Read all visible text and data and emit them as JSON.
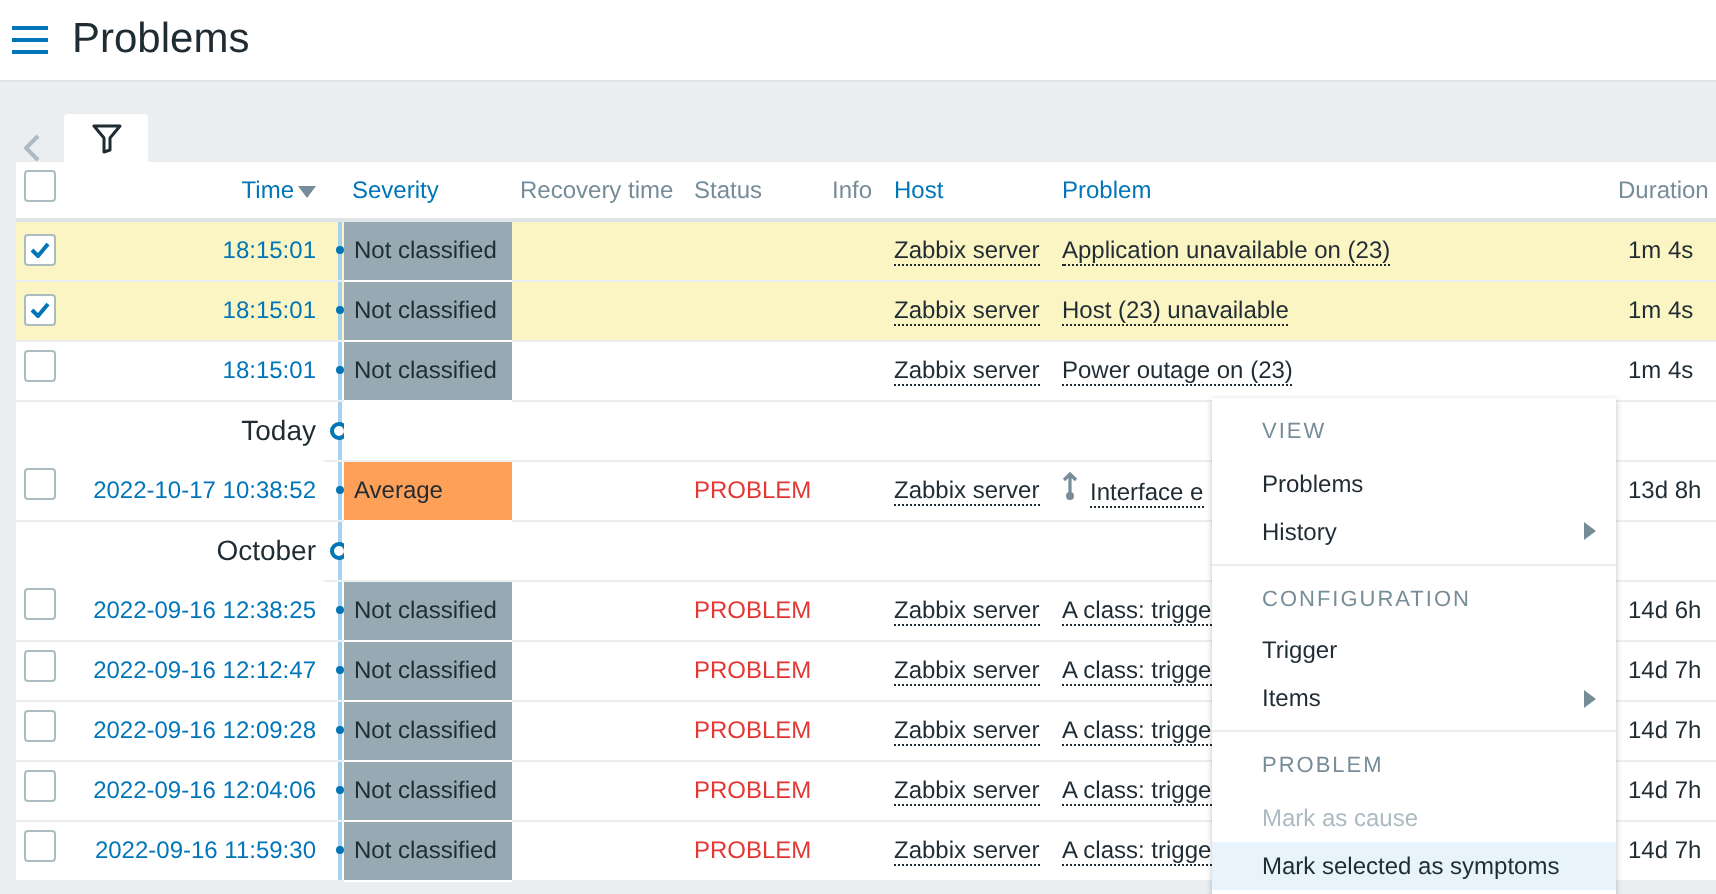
{
  "page": {
    "title": "Problems"
  },
  "table": {
    "select_all": {
      "checked": false
    },
    "columns": [
      {
        "label": "Time",
        "sortable": true,
        "sorted": true
      },
      {
        "label": "Severity",
        "sortable": true,
        "sorted": false
      },
      {
        "label": "Recovery time",
        "sortable": false
      },
      {
        "label": "Status",
        "sortable": false
      },
      {
        "label": "Info",
        "sortable": false
      },
      {
        "label": "Host",
        "sortable": true,
        "sorted": false
      },
      {
        "label": "Problem",
        "sortable": true,
        "sorted": false
      },
      {
        "label": "Duration",
        "sortable": false
      }
    ],
    "rows": [
      {
        "kind": "problem",
        "selected": true,
        "time": "18:15:01",
        "severity": "Not classified",
        "color": "#97aab3",
        "host": "Zabbix server",
        "problem": "Application unavailable on (23)",
        "duration": "1m 4s"
      },
      {
        "kind": "problem",
        "selected": true,
        "time": "18:15:01",
        "severity": "Not classified",
        "color": "#97aab3",
        "host": "Zabbix server",
        "problem": "Host (23) unavailable",
        "duration": "1m 4s"
      },
      {
        "kind": "problem",
        "selected": false,
        "time": "18:15:01",
        "severity": "Not classified",
        "color": "#97aab3",
        "host": "Zabbix server",
        "problem": "Power outage on (23)",
        "duration": "1m 4s"
      },
      {
        "kind": "date",
        "label": "Today"
      },
      {
        "kind": "problem",
        "selected": false,
        "time": "2022-10-17 10:38:52",
        "severity": "Average",
        "color": "#ffa059",
        "status": "PROBLEM",
        "host": "Zabbix server",
        "dependency": true,
        "problem": "Interface e",
        "duration": "13d 8h"
      },
      {
        "kind": "date",
        "label": "October"
      },
      {
        "kind": "problem",
        "selected": false,
        "time": "2022-09-16 12:38:25",
        "severity": "Not classified",
        "color": "#97aab3",
        "status": "PROBLEM",
        "host": "Zabbix server",
        "problem": "A class: trigge",
        "duration": "14d 6h"
      },
      {
        "kind": "problem",
        "selected": false,
        "time": "2022-09-16 12:12:47",
        "severity": "Not classified",
        "color": "#97aab3",
        "status": "PROBLEM",
        "host": "Zabbix server",
        "problem": "A class: trigge",
        "duration": "14d 7h"
      },
      {
        "kind": "problem",
        "selected": false,
        "time": "2022-09-16 12:09:28",
        "severity": "Not classified",
        "color": "#97aab3",
        "status": "PROBLEM",
        "host": "Zabbix server",
        "problem": "A class: trigge",
        "duration": "14d 7h"
      },
      {
        "kind": "problem",
        "selected": false,
        "time": "2022-09-16 12:04:06",
        "severity": "Not classified",
        "color": "#97aab3",
        "status": "PROBLEM",
        "host": "Zabbix server",
        "problem": "A class: trigge",
        "duration": "14d 7h"
      },
      {
        "kind": "problem",
        "selected": false,
        "time": "2022-09-16 11:59:30",
        "severity": "Not classified",
        "color": "#97aab3",
        "status": "PROBLEM",
        "host": "Zabbix server",
        "problem": "A class: trigge",
        "duration": "14d 7h"
      }
    ]
  },
  "context_menu": {
    "items": [
      {
        "kind": "header",
        "label": "VIEW"
      },
      {
        "kind": "item",
        "label": "Problems",
        "submenu": false,
        "disabled": false,
        "highlighted": false
      },
      {
        "kind": "item",
        "label": "History",
        "submenu": true,
        "disabled": false,
        "highlighted": false
      },
      {
        "kind": "divider"
      },
      {
        "kind": "header",
        "label": "CONFIGURATION"
      },
      {
        "kind": "item",
        "label": "Trigger",
        "submenu": false,
        "disabled": false,
        "highlighted": false
      },
      {
        "kind": "item",
        "label": "Items",
        "submenu": true,
        "disabled": false,
        "highlighted": false
      },
      {
        "kind": "divider"
      },
      {
        "kind": "header",
        "label": "PROBLEM"
      },
      {
        "kind": "item",
        "label": "Mark as cause",
        "submenu": false,
        "disabled": true,
        "highlighted": false
      },
      {
        "kind": "item",
        "label": "Mark selected as symptoms",
        "submenu": false,
        "disabled": false,
        "highlighted": true
      }
    ]
  }
}
